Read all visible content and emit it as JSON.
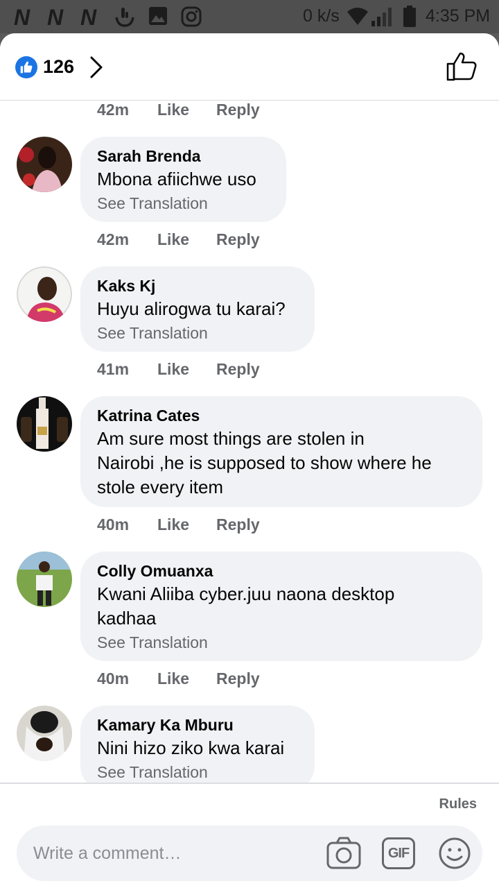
{
  "status_bar": {
    "n_glyph": "N",
    "network_speed": "0 k/s",
    "time": "4:35 PM",
    "icons": [
      "n-notification-icon",
      "n-notification-icon",
      "n-notification-icon",
      "touch-icon",
      "gallery-icon",
      "instagram-icon",
      "wifi-icon",
      "signal-icon",
      "battery-icon"
    ]
  },
  "header": {
    "reaction_count": "126",
    "icons": [
      "like-reaction-icon",
      "chevron-right-icon",
      "thumbs-up-icon"
    ]
  },
  "actions": {
    "like": "Like",
    "reply": "Reply"
  },
  "top_meta": {
    "time": "42m"
  },
  "comments": [
    {
      "name": "Sarah Brenda",
      "lines": [
        "Mbona afiichwe uso"
      ],
      "translation": "See Translation",
      "time": "42m"
    },
    {
      "name": "Kaks Kj",
      "lines": [
        "Huyu alirogwa tu karai?"
      ],
      "translation": "See Translation",
      "time": "41m"
    },
    {
      "name": "Katrina Cates",
      "lines": [
        "Am sure most things are stolen in",
        "Nairobi ,he is supposed to show where he",
        "stole every item"
      ],
      "time": "40m"
    },
    {
      "name": "Colly Omuanxa",
      "lines": [
        "Kwani Aliiba cyber.juu naona desktop",
        "kadhaa"
      ],
      "translation": "See Translation",
      "time": "40m"
    },
    {
      "name": "Kamary Ka Mburu",
      "lines": [
        "Nini hizo ziko kwa karai"
      ],
      "translation": "See Translation"
    }
  ],
  "footer": {
    "rules": "Rules",
    "composer_placeholder": "Write a comment…",
    "gif_label": "GIF",
    "icons": [
      "camera-icon",
      "gif-icon",
      "emoji-icon"
    ]
  },
  "colors": {
    "accent": "#1b74e4",
    "bubble": "#f0f2f5",
    "muted_text": "#65676b"
  }
}
